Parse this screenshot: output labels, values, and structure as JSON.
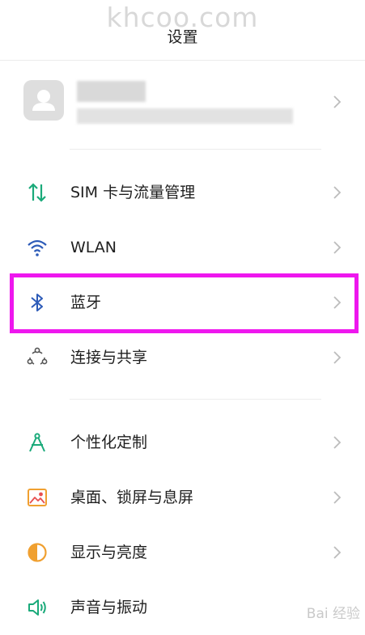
{
  "watermark": "khcoo.com",
  "header": {
    "title": "设置"
  },
  "colors": {
    "highlight": "#ee17ee",
    "sim_icon": "#1aaa7a",
    "wlan_icon": "#2d5bb8",
    "bluetooth_icon": "#2d5bb8",
    "share_icon": "#555555",
    "personalize_icon": "#1aaa7a",
    "wallpaper_icon": "#f0a030",
    "display_icon": "#f0a030",
    "sound_icon": "#1aaa7a"
  },
  "sections": [
    {
      "items": [
        {
          "label": "SIM 卡与流量管理",
          "icon": "sim-transfer-icon"
        },
        {
          "label": "WLAN",
          "icon": "wifi-icon"
        },
        {
          "label": "蓝牙",
          "icon": "bluetooth-icon",
          "highlighted": true
        },
        {
          "label": "连接与共享",
          "icon": "share-nodes-icon"
        }
      ]
    },
    {
      "items": [
        {
          "label": "个性化定制",
          "icon": "compass-icon"
        },
        {
          "label": "桌面、锁屏与息屏",
          "icon": "picture-icon"
        },
        {
          "label": "显示与亮度",
          "icon": "half-circle-icon"
        },
        {
          "label": "声音与振动",
          "icon": "speaker-icon"
        }
      ]
    }
  ],
  "footer_watermark": "Bai 经验"
}
